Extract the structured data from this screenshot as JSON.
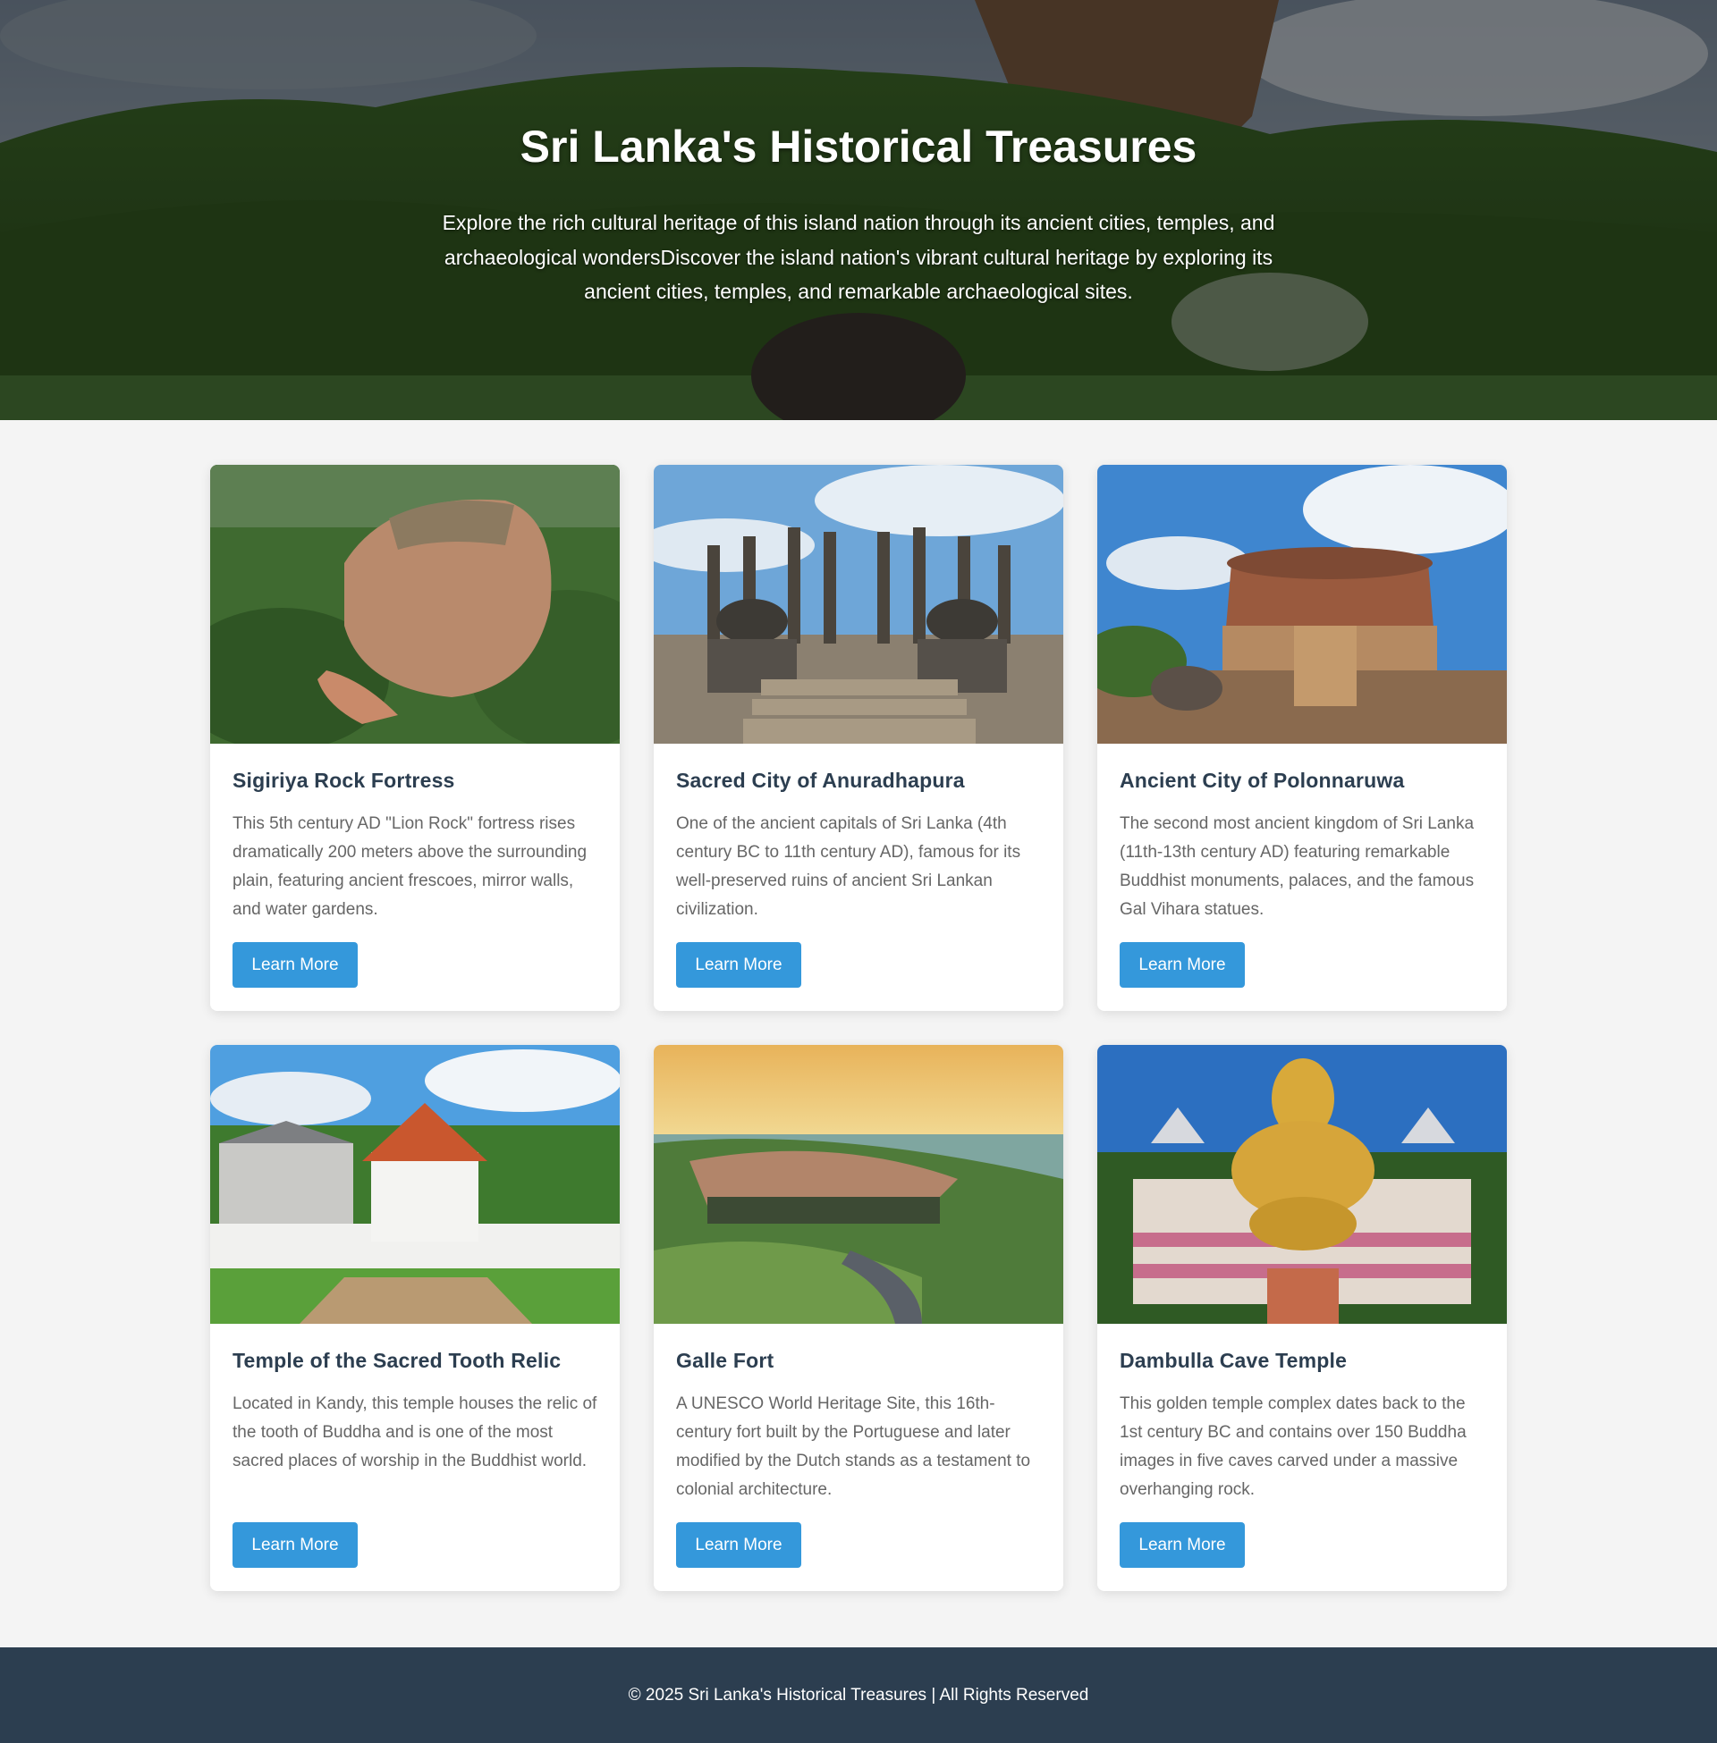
{
  "hero": {
    "title": "Sri Lanka's Historical Treasures",
    "subtitle": "Explore the rich cultural heritage of this island nation through its ancient cities, temples, and archaeological wondersDiscover the island nation's vibrant cultural heritage by exploring its ancient cities, temples, and remarkable archaeological sites."
  },
  "cards": [
    {
      "title": "Sigiriya Rock Fortress",
      "description": "This 5th century AD \"Lion Rock\" fortress rises dramatically 200 meters above the surrounding plain, featuring ancient frescoes, mirror walls, and water gardens.",
      "button": "Learn More"
    },
    {
      "title": "Sacred City of Anuradhapura",
      "description": "One of the ancient capitals of Sri Lanka (4th century BC to 11th century AD), famous for its well-preserved ruins of ancient Sri Lankan civilization.",
      "button": "Learn More"
    },
    {
      "title": "Ancient City of Polonnaruwa",
      "description": "The second most ancient kingdom of Sri Lanka (11th-13th century AD) featuring remarkable Buddhist monuments, palaces, and the famous Gal Vihara statues.",
      "button": "Learn More"
    },
    {
      "title": "Temple of the Sacred Tooth Relic",
      "description": "Located in Kandy, this temple houses the relic of the tooth of Buddha and is one of the most sacred places of worship in the Buddhist world.",
      "button": "Learn More"
    },
    {
      "title": "Galle Fort",
      "description": "A UNESCO World Heritage Site, this 16th-century fort built by the Portuguese and later modified by the Dutch stands as a testament to colonial architecture.",
      "button": "Learn More"
    },
    {
      "title": "Dambulla Cave Temple",
      "description": "This golden temple complex dates back to the 1st century BC and contains over 150 Buddha images in five caves carved under a massive overhanging rock.",
      "button": "Learn More"
    }
  ],
  "footer": {
    "text": "© 2025 Sri Lanka's Historical Treasures | All Rights Reserved"
  },
  "colors": {
    "accent": "#3498db",
    "heading": "#2c3e50",
    "footer_bg": "#2c3e50",
    "page_bg": "#f4f4f4"
  }
}
